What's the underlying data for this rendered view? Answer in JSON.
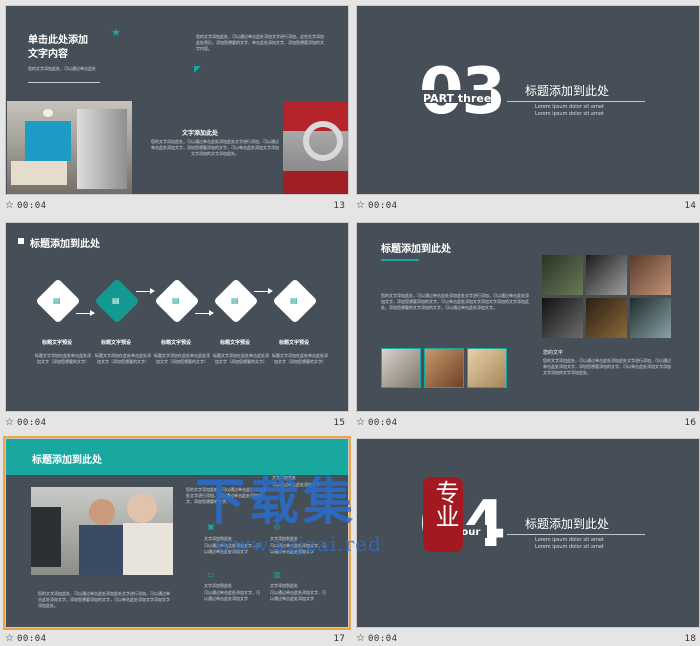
{
  "slides": [
    {
      "number": "13",
      "time": "00:04",
      "title": "单击此处添加\n文字内容",
      "subtitle": "您的文字添加此处，可以通过单击此处",
      "right_text": "您的文字添加此处，可以通过单击此处添加文字进行添加，这些文字添加此处然后，添加您想要的文字，单击此处添加文字，添加您想要添加的文字内容。",
      "caption_title": "文字添加此处",
      "caption_body": "您的文字添加此处，可以通过单击此处添加此处文字进行添加，可以通过单击此处添加文字，添加您想要添加的文字，可以单击此处添加文字添加文字添加的文字添加此处。"
    },
    {
      "number": "14",
      "time": "00:04",
      "big_number": "03",
      "part": "PART three",
      "heading": "标题添加到此处",
      "lorem1": "Lorem ipsum dolor sit amet",
      "lorem2": "Lorem ipsum dolor sit amet"
    },
    {
      "number": "15",
      "time": "00:04",
      "title": "标题添加到此处",
      "steps": [
        {
          "label": "标题文字预设",
          "desc": "标题文字添加在此处单击此处添加文字（添加您想要的文字）"
        },
        {
          "label": "标题文字预设",
          "desc": "标题文字添加在此处单击此处添加文字（添加您想要的文字）"
        },
        {
          "label": "标题文字预设",
          "desc": "标题文字添加在此处单击此处添加文字（添加您想要的文字）"
        },
        {
          "label": "标题文字预设",
          "desc": "标题文字添加在此处单击此处添加文字（添加您想要的文字）"
        },
        {
          "label": "标题文字预设",
          "desc": "标题文字添加在此处单击此处添加文字（添加您想要的文字）"
        }
      ]
    },
    {
      "number": "16",
      "time": "00:04",
      "title": "标题添加到此处",
      "body": "您的文字添加此处，可以通过单击此处添加此处文字进行添加，可以通过单击此处添加文字，添加您想要添加的文字，可以单击此处添加文字添加文字添加的文字添加此处。添加您想要的文字添加的文字，可以通过单击此处添加文字。",
      "caption_title": "您的文字",
      "caption_body": "您的文字添加此处，可以通过单击此处添加此处文字进行添加，可以通过单击此处添加文字，添加您想要添加的文字，可以单击此处添加文字添加文字添加的文字添加此处。"
    },
    {
      "number": "17",
      "time": "00:04",
      "title": "标题添加到此处",
      "body": "您的文字添加此处，可以通过单击此处添加此处文字进行添加，可以通过单击此处添加文字，添加您想要的文字。",
      "items": [
        {
          "title": "文字添加此处",
          "desc": "可以通过单击此处添加文字"
        },
        {
          "title": "文字添加到此处",
          "desc": "可以通过单击此处添加文字，可以通过单击此处添加文字"
        },
        {
          "title": "文字添加到此处",
          "desc": "可以通过单击此处添加文字，可以通过单击此处添加文字"
        },
        {
          "title": "文字添加到此处",
          "desc": "可以通过单击此处添加文字，可以通过单击此处添加文字"
        },
        {
          "title": "文字添加到此处",
          "desc": "可以通过单击此处添加文字，可以通过单击此处添加文字"
        }
      ],
      "footer": "您的文字添加此处，可以通过单击此处添加此处文字进行添加，可以通过单击此处添加文字，添加您想要添加的文字，可以单击此处添加文字添加文字添加此处。"
    },
    {
      "number": "18",
      "time": "00:04",
      "big_number": "04",
      "part": "four",
      "heading": "标题添加到此处",
      "lorem1": "Lorem ipsum dolor sit amet",
      "lorem2": "Lorem ipsum dolor sit amet"
    }
  ],
  "watermark": {
    "main": "下载集",
    "seal": "专业",
    "url": "www.xzjzai.red"
  },
  "colors": {
    "accent": "#19a8a0",
    "slide_bg": "#464e57",
    "selection": "#f0a24a"
  }
}
